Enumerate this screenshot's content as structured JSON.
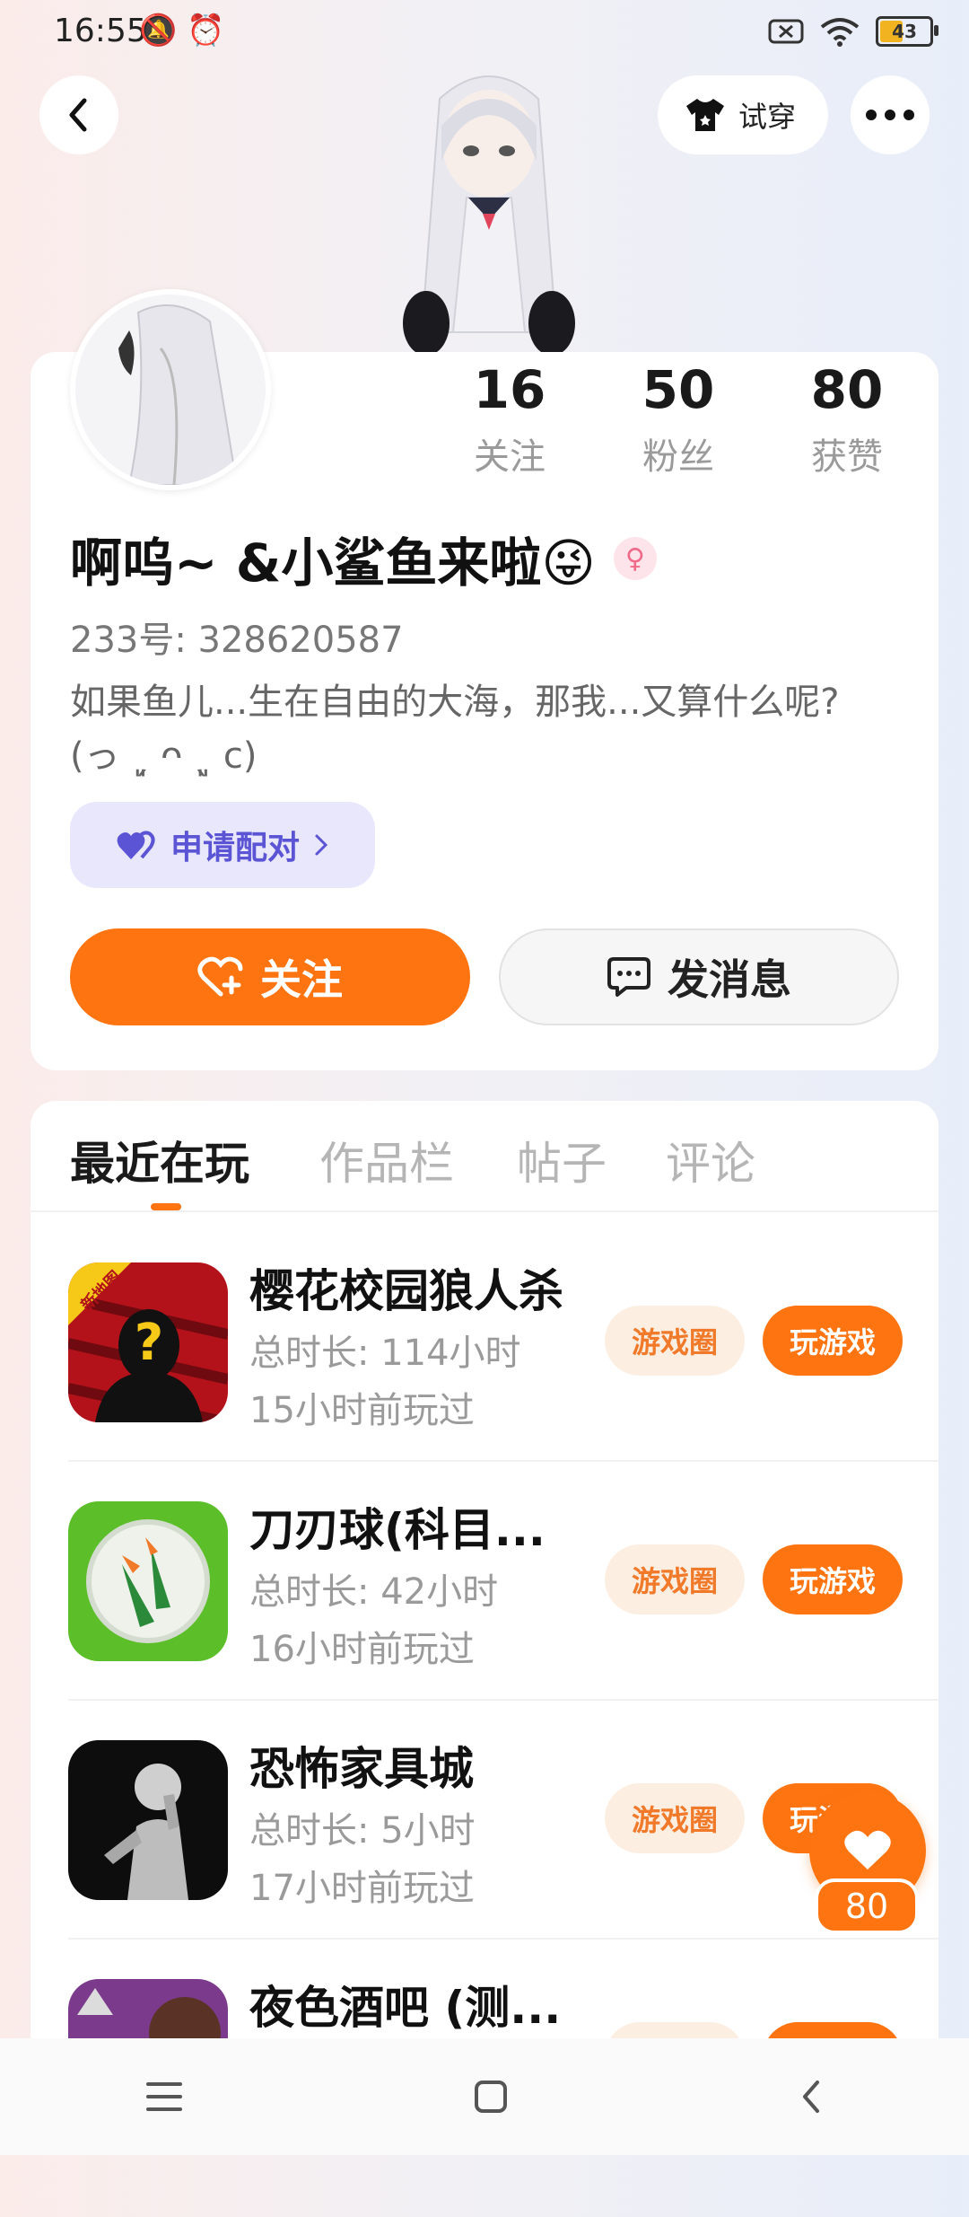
{
  "status_bar": {
    "time": "16:55",
    "battery": "43"
  },
  "header": {
    "try_on_label": "试穿"
  },
  "stats": [
    {
      "value": "16",
      "label": "关注"
    },
    {
      "value": "50",
      "label": "粉丝"
    },
    {
      "value": "80",
      "label": "获赞"
    }
  ],
  "profile": {
    "nickname": "啊呜~ &小鲨鱼来啦😜",
    "uid": "233号: 328620587",
    "bio": "如果鱼儿...生在自由的大海，那我...又算什么呢?(っ ˏ͈ ᴖ ˎ͈ c)",
    "pair_label": "申请配对"
  },
  "actions": {
    "follow_label": "关注",
    "message_label": "发消息"
  },
  "tabs": [
    {
      "label": "最近在玩"
    },
    {
      "label": "作品栏"
    },
    {
      "label": "帖子"
    },
    {
      "label": "评论"
    }
  ],
  "games": [
    {
      "title": "樱花校园狼人杀",
      "duration": "总时长: 114小时",
      "last_played": "15小时前玩过",
      "circle_label": "游戏圈",
      "play_label": "玩游戏",
      "badge": "新地图"
    },
    {
      "title": "刀刃球(科目...",
      "duration": "总时长: 42小时",
      "last_played": "16小时前玩过",
      "circle_label": "游戏圈",
      "play_label": "玩游戏"
    },
    {
      "title": "恐怖家具城",
      "duration": "总时长: 5小时",
      "last_played": "17小时前玩过",
      "circle_label": "游戏圈",
      "play_label": "玩游戏"
    },
    {
      "title": "夜色酒吧 (测..."
    }
  ],
  "floating_like": {
    "count": "80"
  },
  "colors": {
    "accent": "#fd7411",
    "pair_bg": "#e9e7fb",
    "pair_text": "#5b55d6"
  }
}
